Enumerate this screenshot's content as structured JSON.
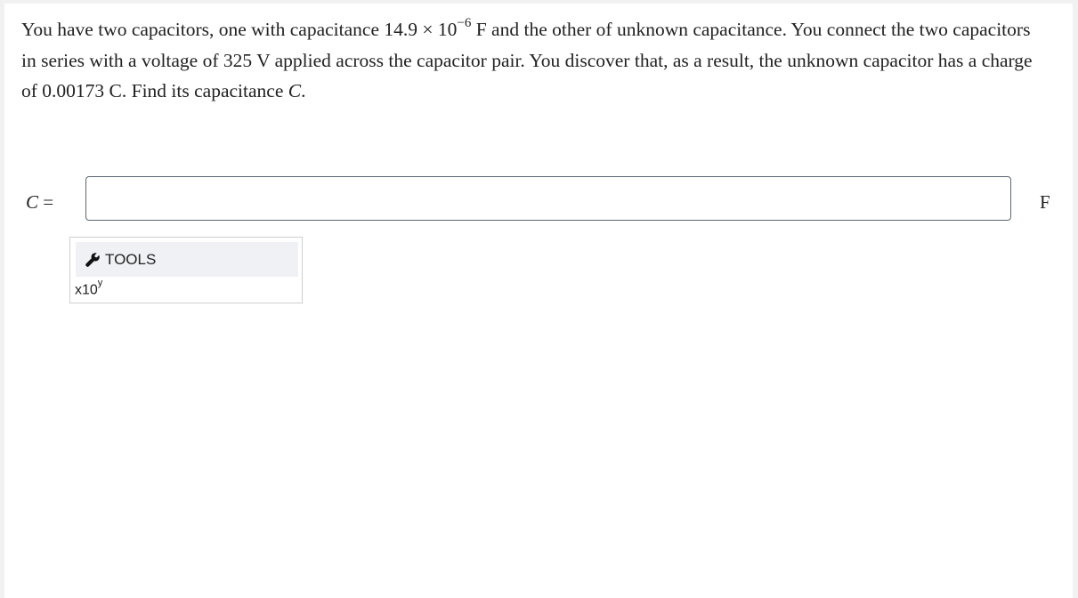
{
  "question": {
    "part1": "You have two capacitors, one with capacitance 14.9 × 10",
    "exponent": "−6",
    "part2": " F and the other of unknown capacitance. You connect the two capacitors in series with a voltage of 325 V applied across the capacitor pair. You discover that, as a result, the unknown capacitor has a charge of 0.00173 C. Find its capacitance ",
    "variable": "C",
    "end": "."
  },
  "answer": {
    "label_var": "C",
    "label_eq": " =",
    "value": "",
    "placeholder": "",
    "unit": "F"
  },
  "tools": {
    "header_label": "TOOLS",
    "icon": "wrench-icon",
    "x10_base": "x10",
    "x10_exp": "y"
  }
}
